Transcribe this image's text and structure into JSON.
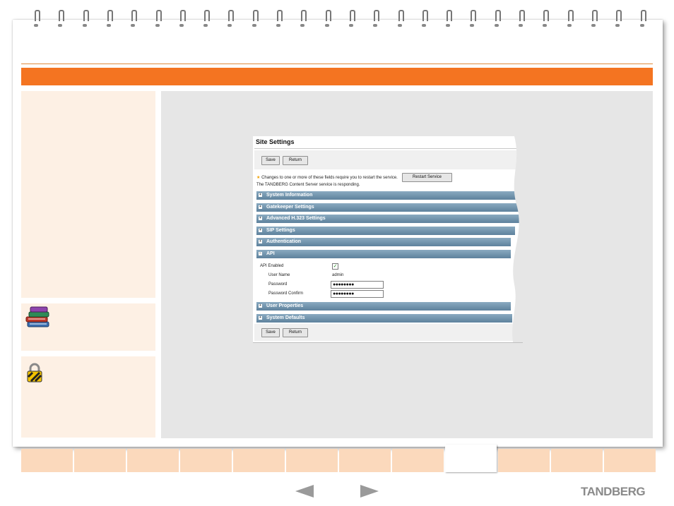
{
  "brand": "TANDBERG",
  "nav": {
    "tab_count": 12,
    "active_tab_index": 8,
    "prev_icon": "arrow-left-icon",
    "next_icon": "arrow-right-icon"
  },
  "colors": {
    "accent": "#f47421",
    "panel": "#fdf0e4",
    "tab": "#fbd9bc",
    "main_bg": "#e6e6e6",
    "section_bar": "#6f93ad"
  },
  "sidebar": {
    "books_icon": "books-icon",
    "lock_icon": "padlock-icon"
  },
  "site_settings": {
    "title": "Site Settings",
    "save_label": "Save",
    "return_label": "Return",
    "restart_note": "Changes to one or more of these fields require you to restart the service.",
    "restart_button": "Restart Service",
    "status": "The TANDBERG Content Server service is responding.",
    "sections": [
      "System Information",
      "Gatekeeper Settings",
      "Advanced H.323 Settings",
      "SIP Settings",
      "Authentication",
      "API",
      "User Properties",
      "System Defaults"
    ],
    "api": {
      "enabled_label": "API Enabled",
      "enabled": true,
      "username_label": "User Name",
      "username_value": "admin",
      "password_label": "Password",
      "password_value": "●●●●●●●●",
      "password_confirm_label": "Password Confirm",
      "password_confirm_value": "●●●●●●●●"
    }
  }
}
